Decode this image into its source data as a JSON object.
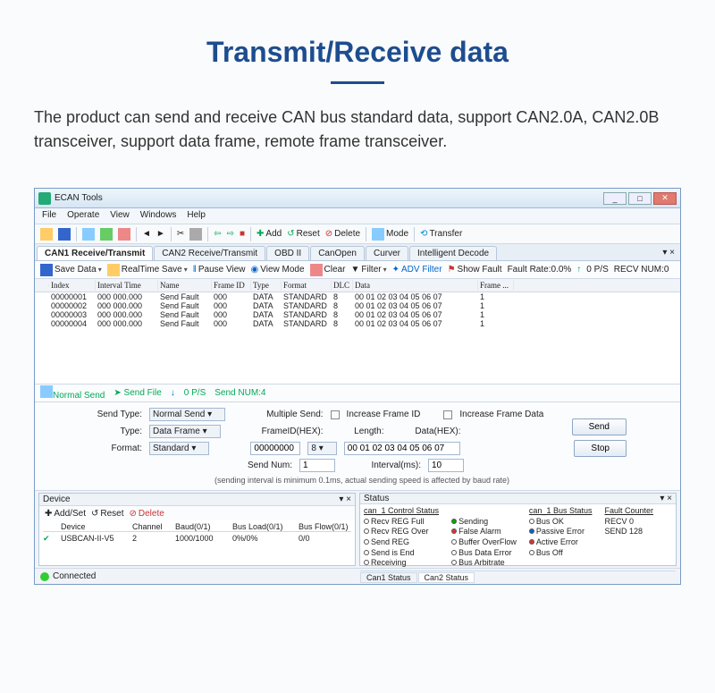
{
  "hero": {
    "title": "Transmit/Receive data",
    "desc": "The product can send and receive CAN bus standard data, support CAN2.0A, CAN2.0B transceiver, support data frame, remote frame transceiver."
  },
  "app": {
    "title": "ECAN Tools"
  },
  "menus": [
    "File",
    "Operate",
    "View",
    "Windows",
    "Help"
  ],
  "tb": {
    "add": "Add",
    "reset": "Reset",
    "delete": "Delete",
    "mode": "Mode",
    "transfer": "Transfer"
  },
  "tabs": [
    {
      "l": "CAN1 Receive/Transmit",
      "a": true
    },
    {
      "l": "CAN2 Receive/Transmit"
    },
    {
      "l": "OBD II"
    },
    {
      "l": "CanOpen"
    },
    {
      "l": "Curver"
    },
    {
      "l": "Intelligent Decode"
    }
  ],
  "sub": {
    "save": "Save Data",
    "rts": "RealTime Save",
    "pause": "Pause View",
    "vm": "View Mode",
    "clear": "Clear",
    "filter": "Filter",
    "adv": "ADV Filter",
    "fault": "Show Fault",
    "rate": "Fault Rate:0.0%",
    "ps": "0 P/S",
    "recv": "RECV NUM:0"
  },
  "cols": [
    "",
    "Index",
    "Interval Time",
    "Name",
    "Frame ID",
    "Type",
    "Format",
    "DLC",
    "Data",
    "Frame ..."
  ],
  "rows": [
    [
      "",
      "00000001",
      "000 000.000",
      "Send Fault",
      "000",
      "DATA",
      "STANDARD",
      "8",
      "00 01 02 03 04 05 06 07",
      "1"
    ],
    [
      "",
      "00000002",
      "000 000.000",
      "Send Fault",
      "000",
      "DATA",
      "STANDARD",
      "8",
      "00 01 02 03 04 05 06 07",
      "1"
    ],
    [
      "",
      "00000003",
      "000 000.000",
      "Send Fault",
      "000",
      "DATA",
      "STANDARD",
      "8",
      "00 01 02 03 04 05 06 07",
      "1"
    ],
    [
      "",
      "00000004",
      "000 000.000",
      "Send Fault",
      "000",
      "DATA",
      "STANDARD",
      "8",
      "00 01 02 03 04 05 06 07",
      "1"
    ]
  ],
  "sendbar": {
    "ns": "Normal Send",
    "sf": "Send File",
    "ps": "0 P/S",
    "sn": "Send NUM:4"
  },
  "panel": {
    "sendtype_l": "Send Type:",
    "sendtype_v": "Normal Send",
    "type_l": "Type:",
    "type_v": "Data Frame",
    "format_l": "Format:",
    "format_v": "Standard",
    "multi": "Multiple Send:",
    "incid": "Increase Frame ID",
    "incdata": "Increase Frame Data",
    "fid_l": "FrameID(HEX):",
    "fid_v": "00000000",
    "len_l": "Length:",
    "len_v": "8",
    "data_l": "Data(HEX):",
    "data_v": "00 01 02 03 04 05 06 07",
    "sn_l": "Send Num:",
    "sn_v": "1",
    "int_l": "Interval(ms):",
    "int_v": "10",
    "send": "Send",
    "stop": "Stop",
    "note": "(sending interval is minimum 0.1ms, actual sending speed is affected by baud rate)"
  },
  "dev": {
    "title": "Device",
    "add": "Add/Set",
    "reset": "Reset",
    "del": "Delete",
    "heads": [
      "",
      "Device",
      "Channel",
      "Baud(0/1)",
      "Bus Load(0/1)",
      "Bus Flow(0/1)"
    ],
    "row": [
      "✔",
      "USBCAN-II-V5",
      "2",
      "1000/1000",
      "0%/0%",
      "0/0"
    ]
  },
  "stat": {
    "title": "Status",
    "c1h": "can_1 Control Status",
    "c1": [
      "Recv REG Full",
      "Recv REG Over",
      "Send REG",
      "Send is End",
      "Receiving"
    ],
    "c2": [
      "Sending",
      "False Alarm",
      "Buffer OverFlow",
      "Bus Data Error",
      "Bus Arbitrate"
    ],
    "c3h": "can_1 Bus Status",
    "c3": [
      "Bus OK",
      "Passive Error",
      "Active Error",
      "Bus Off"
    ],
    "fch": "Fault Counter",
    "fc": [
      "RECV   0",
      "SEND   128"
    ],
    "t1": "Can1 Status",
    "t2": "Can2 Status"
  },
  "status": {
    "conn": "Connected"
  }
}
